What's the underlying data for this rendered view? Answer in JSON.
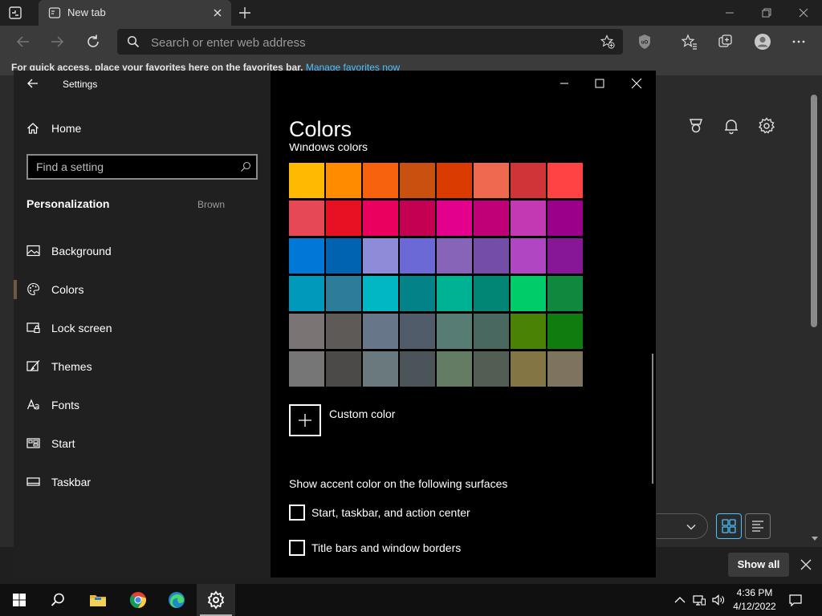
{
  "browser": {
    "tab_title": "New tab",
    "address_placeholder": "Search or enter web address",
    "favorites_bar_text": "For quick access, place your favorites here on the favorites bar.",
    "favorites_bar_link": "Manage favorites now",
    "show_all_label": "Show all",
    "accent_link_color": "#4cc2ff"
  },
  "settings": {
    "window_title": "Settings",
    "home_label": "Home",
    "search_placeholder": "Find a setting",
    "section_heading": "Personalization",
    "section_value": "Brown",
    "nav_items": [
      {
        "label": "Background",
        "icon": "image-icon"
      },
      {
        "label": "Colors",
        "icon": "palette-icon",
        "selected": true
      },
      {
        "label": "Lock screen",
        "icon": "lock-screen-icon"
      },
      {
        "label": "Themes",
        "icon": "brush-icon"
      },
      {
        "label": "Fonts",
        "icon": "font-icon"
      },
      {
        "label": "Start",
        "icon": "start-layout-icon"
      },
      {
        "label": "Taskbar",
        "icon": "taskbar-icon"
      }
    ],
    "page_title": "Colors",
    "sub_heading": "Windows colors",
    "swatches": [
      [
        "#ffb900",
        "#ff8c00",
        "#f7630c",
        "#ca5010",
        "#da3b01",
        "#ef6950",
        "#d13438",
        "#ff4343"
      ],
      [
        "#e74856",
        "#e81123",
        "#ea005e",
        "#c30052",
        "#e3008c",
        "#bf0077",
        "#c239b3",
        "#9a0089"
      ],
      [
        "#0078d7",
        "#0063b1",
        "#8e8cd8",
        "#6b69d6",
        "#8764b8",
        "#744da9",
        "#b146c2",
        "#881798"
      ],
      [
        "#0099bc",
        "#2d7d9a",
        "#00b7c3",
        "#038387",
        "#00b294",
        "#018574",
        "#00cc6a",
        "#10893e"
      ],
      [
        "#7a7574",
        "#5d5a58",
        "#68768a",
        "#515c6b",
        "#567c73",
        "#486860",
        "#498205",
        "#107c10"
      ],
      [
        "#767676",
        "#4c4a48",
        "#69797e",
        "#4a5459",
        "#647c64",
        "#525e54",
        "#847545",
        "#7e735f"
      ]
    ],
    "custom_color_label": "Custom color",
    "surfaces_heading": "Show accent color on the following surfaces",
    "checkboxes": [
      {
        "label": "Start, taskbar, and action center",
        "checked": false
      },
      {
        "label": "Title bars and window borders",
        "checked": false
      }
    ],
    "selected_indicator_color": "#6e5a43"
  },
  "taskbar": {
    "apps": [
      "windows-start-icon",
      "search-icon",
      "file-explorer-icon",
      "chrome-icon",
      "edge-icon",
      "settings-gear-icon"
    ],
    "time": "4:36 PM",
    "date": "4/12/2022"
  }
}
